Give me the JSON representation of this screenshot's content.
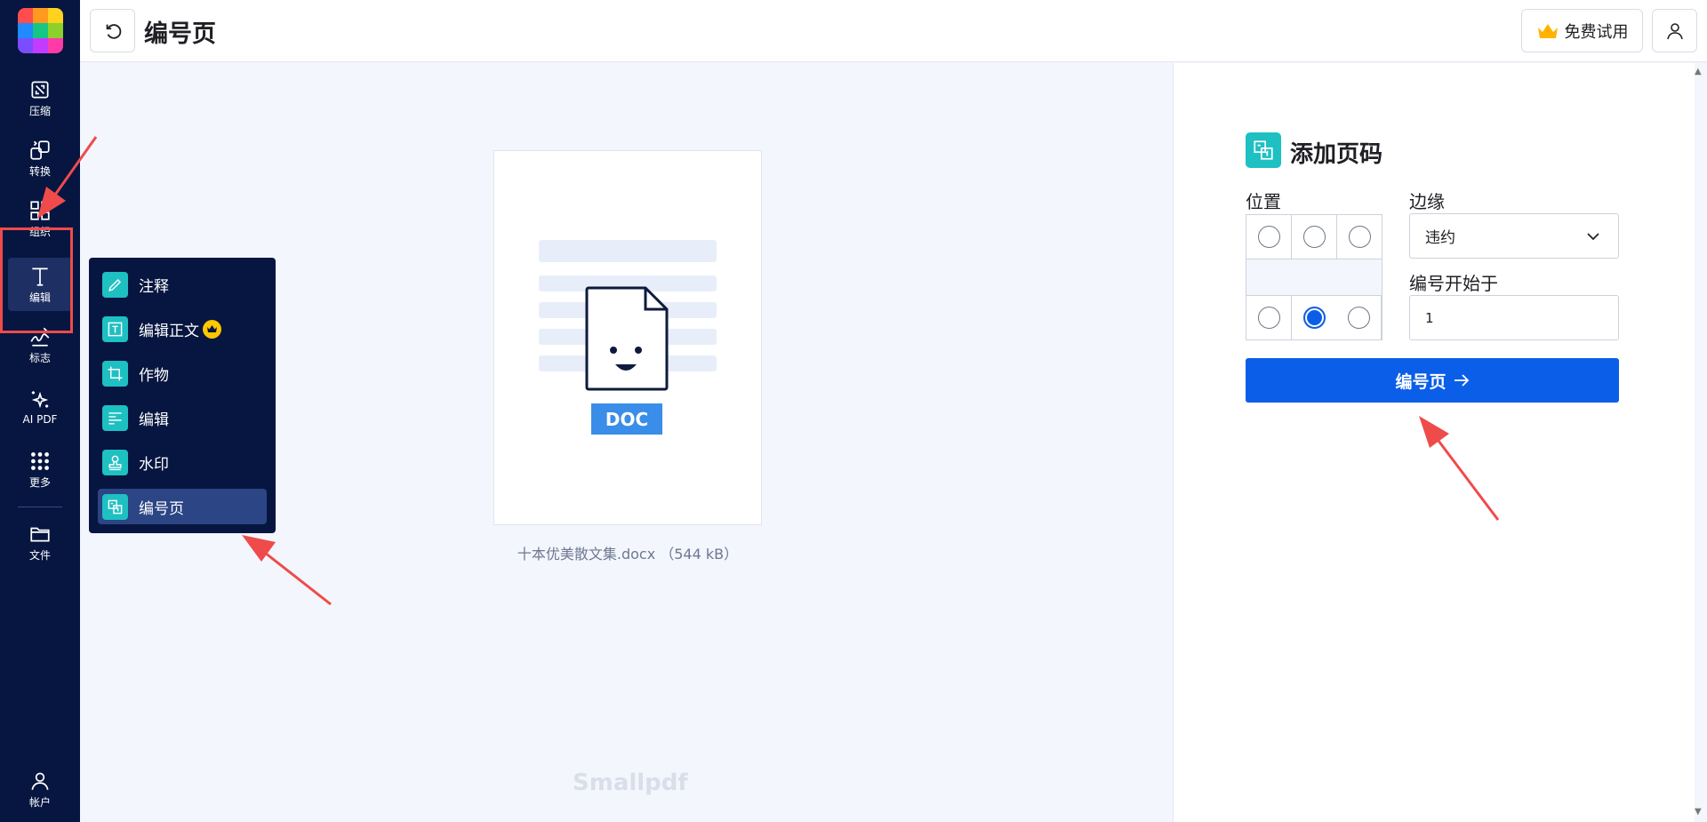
{
  "header": {
    "title": "编号页",
    "trial_label": "免费试用"
  },
  "sidebar": {
    "items": [
      {
        "label": "压缩",
        "icon": "compress-icon"
      },
      {
        "label": "转换",
        "icon": "convert-icon"
      },
      {
        "label": "组织",
        "icon": "organize-icon"
      },
      {
        "label": "编辑",
        "icon": "edit-icon"
      },
      {
        "label": "标志",
        "icon": "sign-icon"
      },
      {
        "label": "AI PDF",
        "icon": "sparkle-icon"
      },
      {
        "label": "更多",
        "icon": "grid-dots-icon"
      },
      {
        "label": "文件",
        "icon": "folder-icon"
      }
    ],
    "account_label": "帐户",
    "active_item": "编辑"
  },
  "flyout": {
    "items": [
      {
        "label": "注释",
        "icon": "pencil-icon"
      },
      {
        "label": "编辑正文",
        "icon": "text-box-icon",
        "premium": true
      },
      {
        "label": "作物",
        "icon": "crop-icon"
      },
      {
        "label": "编辑",
        "icon": "layout-edit-icon"
      },
      {
        "label": "水印",
        "icon": "stamp-icon"
      },
      {
        "label": "编号页",
        "icon": "page-number-icon",
        "active": true
      }
    ]
  },
  "preview": {
    "badge": "DOC",
    "filename": "十本优美散文集.docx （544 kB）",
    "brand": "Smallpdf"
  },
  "panel": {
    "title": "添加页码",
    "position_label": "位置",
    "margin_label": "边缘",
    "margin_value": "违约",
    "start_label": "编号开始于",
    "start_value": "1",
    "submit_label": "编号页",
    "selected_position": "bottom-center"
  },
  "colors": {
    "sidebar_bg": "#061640",
    "accent_blue": "#0b5ee8",
    "teal": "#1ec0c2",
    "annotation_red": "#ef4b4b"
  }
}
